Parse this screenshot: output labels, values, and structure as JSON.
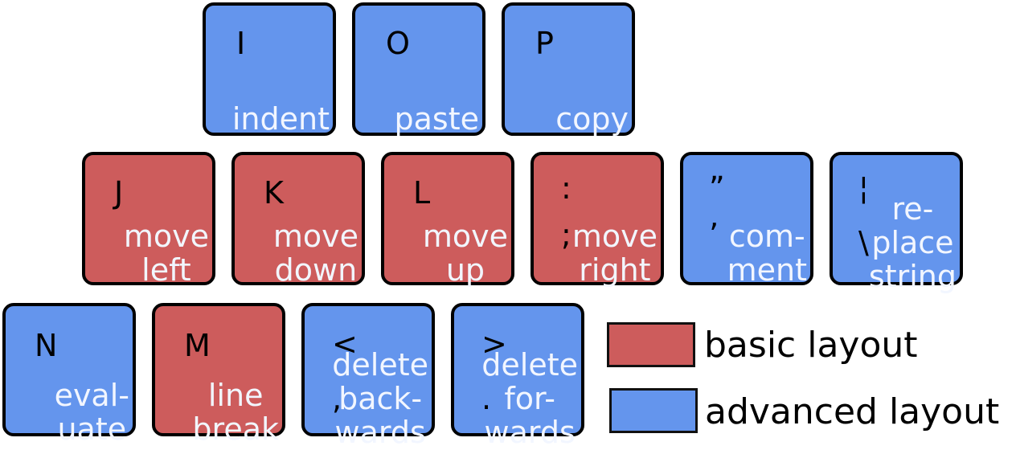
{
  "colors": {
    "basic": "#cd5c5c",
    "advanced": "#6495ed",
    "border": "#000000",
    "label_text": "#f2f6ff"
  },
  "rows": [
    {
      "keys": [
        {
          "glyph_top": "I",
          "glyph_bottom": "",
          "label": "indent",
          "layout": "advanced"
        },
        {
          "glyph_top": "O",
          "glyph_bottom": "",
          "label": "paste",
          "layout": "advanced"
        },
        {
          "glyph_top": "P",
          "glyph_bottom": "",
          "label": "copy",
          "layout": "advanced"
        }
      ]
    },
    {
      "keys": [
        {
          "glyph_top": "J",
          "glyph_bottom": "",
          "label": "move\nleft",
          "layout": "basic"
        },
        {
          "glyph_top": "K",
          "glyph_bottom": "",
          "label": "move\ndown",
          "layout": "basic"
        },
        {
          "glyph_top": "L",
          "glyph_bottom": "",
          "label": "move\nup",
          "layout": "basic"
        },
        {
          "glyph_top": ":",
          "glyph_bottom": ";",
          "label": "move\nright",
          "layout": "basic"
        },
        {
          "glyph_top": "”",
          "glyph_bottom": "’",
          "label": "com-\nment",
          "layout": "advanced"
        },
        {
          "glyph_top": "¦",
          "glyph_bottom": "\\",
          "label": "re-\nplace\nstring",
          "layout": "advanced"
        }
      ]
    },
    {
      "keys": [
        {
          "glyph_top": "N",
          "glyph_bottom": "",
          "label": "eval-\nuate",
          "layout": "advanced"
        },
        {
          "glyph_top": "M",
          "glyph_bottom": "",
          "label": "line\nbreak",
          "layout": "basic"
        },
        {
          "glyph_top": "<",
          "glyph_bottom": ",",
          "label": "delete\nback-\nwards",
          "layout": "advanced"
        },
        {
          "glyph_top": ">",
          "glyph_bottom": ".",
          "label": "delete\nfor-\nwards",
          "layout": "advanced"
        }
      ]
    }
  ],
  "legend": {
    "basic": "basic layout",
    "advanced": "advanced layout"
  }
}
